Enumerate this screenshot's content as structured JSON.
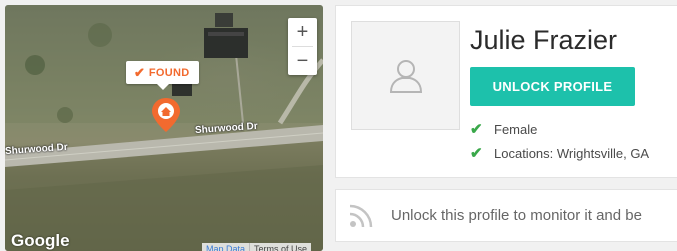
{
  "map": {
    "zoom_in_label": "+",
    "zoom_out_label": "−",
    "found_label": "FOUND",
    "road_labels": [
      "Shurwood Dr",
      "Shurwood Dr"
    ],
    "logo_text": "Google",
    "footer": {
      "map_data": "Map Data",
      "terms": "Terms of Use"
    }
  },
  "profile": {
    "name": "Julie Frazier",
    "unlock_label": "UNLOCK PROFILE",
    "facts": [
      "Female",
      "Locations: Wrightsville, GA"
    ]
  },
  "monitor": {
    "text": "Unlock this profile to monitor it and be"
  },
  "colors": {
    "accent": "#1dc1ab",
    "found": "#f26a2f",
    "check": "#3aa84a"
  },
  "icons": [
    "home-pin-icon",
    "person-placeholder-icon",
    "check-icon",
    "rss-icon"
  ]
}
